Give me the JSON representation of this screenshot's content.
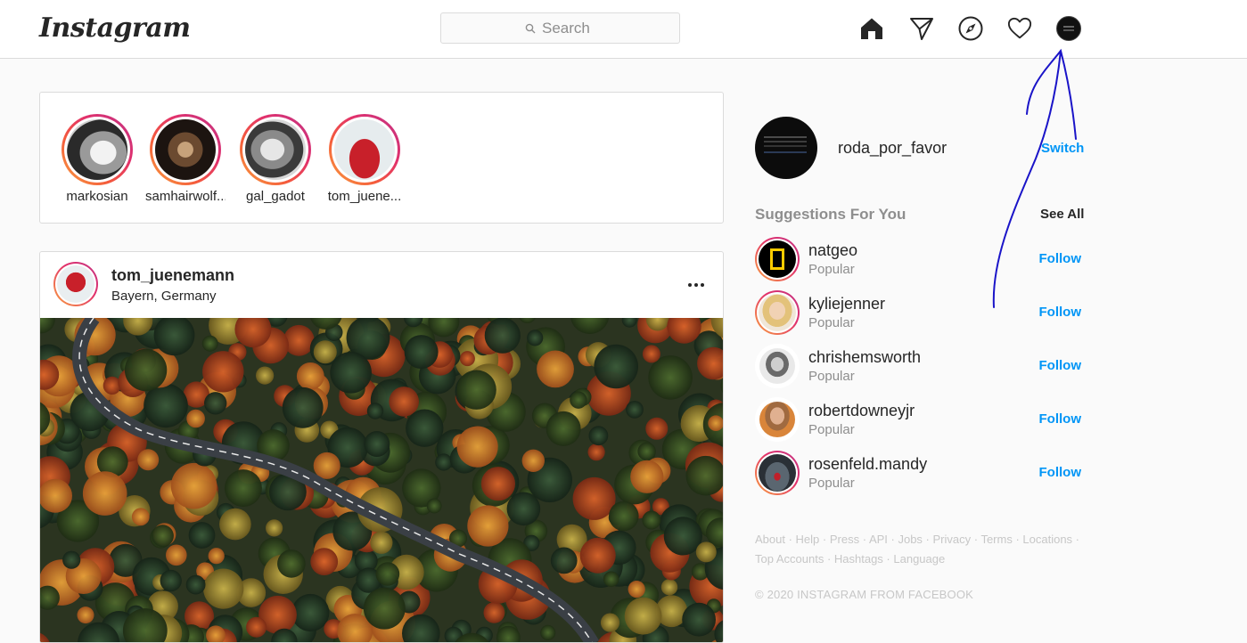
{
  "header": {
    "logo_text": "Instagram",
    "search_placeholder": "Search",
    "icons": [
      "home-icon",
      "direct-message-icon",
      "explore-compass-icon",
      "activity-heart-icon",
      "profile-avatar"
    ]
  },
  "stories": [
    {
      "username": "markosian"
    },
    {
      "username": "samhairwolf..."
    },
    {
      "username": "gal_gadot"
    },
    {
      "username": "tom_juene..."
    }
  ],
  "post": {
    "username": "tom_juenemann",
    "location": "Bayern, Germany"
  },
  "sidebar": {
    "current_user": "roda_por_favor",
    "switch_label": "Switch",
    "suggestions_title": "Suggestions For You",
    "see_all_label": "See All",
    "suggestions": [
      {
        "username": "natgeo",
        "subtitle": "Popular",
        "action": "Follow"
      },
      {
        "username": "kyliejenner",
        "subtitle": "Popular",
        "action": "Follow"
      },
      {
        "username": "chrishemsworth",
        "subtitle": "Popular",
        "action": "Follow"
      },
      {
        "username": "robertdowneyjr",
        "subtitle": "Popular",
        "action": "Follow"
      },
      {
        "username": "rosenfeld.mandy",
        "subtitle": "Popular",
        "action": "Follow"
      }
    ],
    "footer_links": [
      "About",
      "Help",
      "Press",
      "API",
      "Jobs",
      "Privacy",
      "Terms",
      "Locations",
      "Top Accounts",
      "Hashtags",
      "Language"
    ],
    "copyright": "© 2020 INSTAGRAM FROM FACEBOOK"
  },
  "colors": {
    "accent_blue": "#0095f6",
    "border": "#dbdbdb",
    "background": "#fafafa",
    "annotation_ink": "#1a14c8"
  }
}
